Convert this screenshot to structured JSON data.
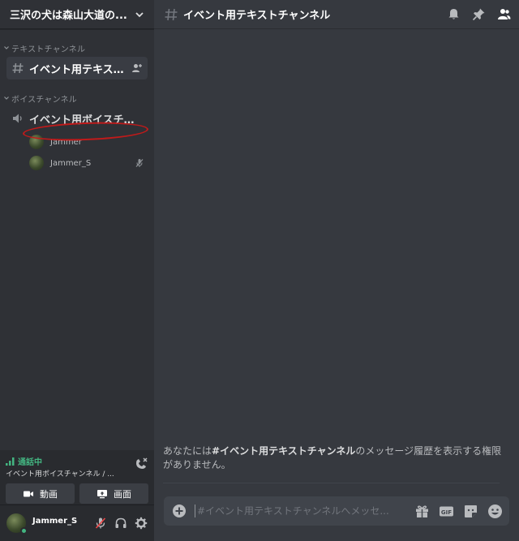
{
  "server": {
    "name": "三沢の犬は森山大道の..."
  },
  "sidebar": {
    "text_category": "テキストチャンネル",
    "text_channel": "イベント用テキスト...",
    "voice_category": "ボイスチャンネル",
    "voice_channel": "イベント用ボイスチャ...",
    "voice_users": [
      {
        "name": "Jammer",
        "status_icon": "none"
      },
      {
        "name": "Jammer_S",
        "status_icon": "mic-muted-icon"
      }
    ]
  },
  "voice_panel": {
    "status": "通話中",
    "channel": "イベント用ボイスチャンネル / ...",
    "video_label": "動画",
    "screen_label": "画面"
  },
  "user_panel": {
    "name": "Jammer_S"
  },
  "main": {
    "channel_title": "イベント用テキストチャンネル",
    "no_permission_prefix": "あなたには",
    "no_permission_channel": "#イベント用テキストチャンネル",
    "no_permission_suffix": "のメッセージ履歴を表示する権限がありません。",
    "composer_placeholder": "#イベント用テキストチャンネルへメッセ..."
  },
  "colors": {
    "sidebar_bg": "#2f3136",
    "main_bg": "#36393f",
    "connected_green": "#43b581",
    "annotation_red": "#c11a1a"
  }
}
